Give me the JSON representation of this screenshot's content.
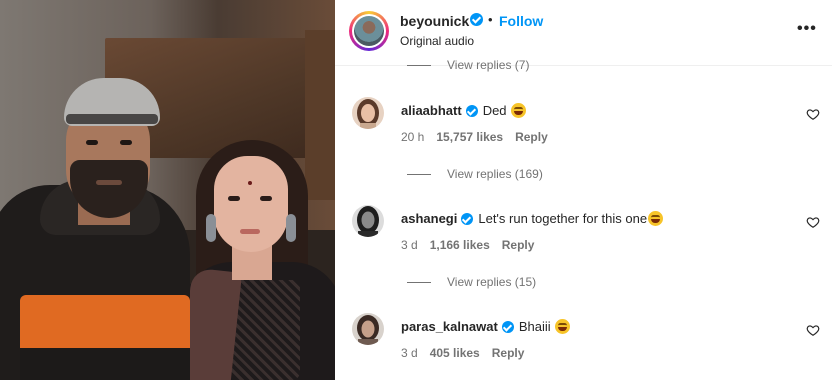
{
  "header": {
    "username": "beyounick",
    "separator": "•",
    "follow_label": "Follow",
    "subtitle": "Original audio",
    "more_label": "•••"
  },
  "top_view_replies": "View replies (7)",
  "comments": [
    {
      "username": "aliaabhatt",
      "text": "Ded",
      "emoji": "rolling-on-floor-laughing",
      "time": "20 h",
      "likes": "15,757 likes",
      "reply_label": "Reply",
      "view_replies": "View replies (169)"
    },
    {
      "username": "ashanegi",
      "text": "Let's run together for this one",
      "emoji": "rolling-on-floor-laughing",
      "time": "3 d",
      "likes": "1,166 likes",
      "reply_label": "Reply",
      "view_replies": "View replies (15)"
    },
    {
      "username": "paras_kalnawat",
      "text": "Bhaiii",
      "emoji": "rolling-on-floor-laughing",
      "time": "3 d",
      "likes": "405 likes",
      "reply_label": "Reply"
    }
  ],
  "colors": {
    "accent": "#0095f6",
    "muted_text": "#737373",
    "primary_text": "#262626"
  }
}
